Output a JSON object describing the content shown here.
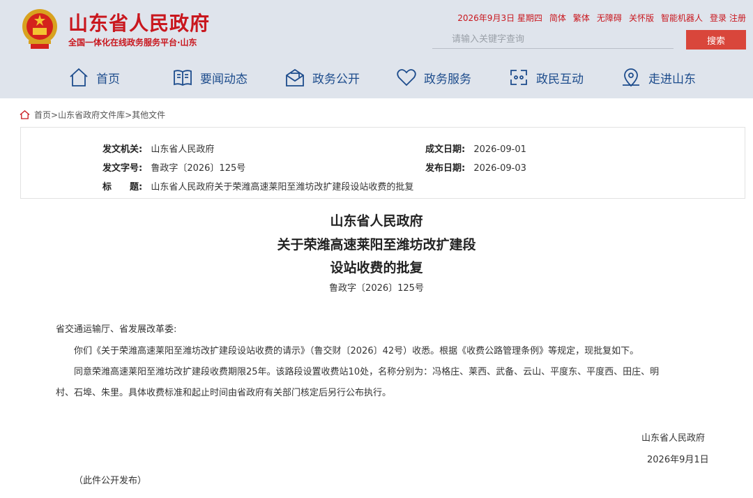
{
  "header": {
    "title": "山东省人民政府",
    "subtitle": "全国一体化在线政务服务平台·山东",
    "date": "2026年9月3日 星期四",
    "links": [
      "简体",
      "繁体",
      "无障碍",
      "关怀版",
      "智能机器人"
    ],
    "login": "登录",
    "register": "注册",
    "search_placeholder": "请输入关键字查询",
    "search_button": "搜索",
    "brand_color": "#c9171e"
  },
  "nav": {
    "items": [
      {
        "label": "首页",
        "icon": "home-icon"
      },
      {
        "label": "要闻动态",
        "icon": "book-icon"
      },
      {
        "label": "政务公开",
        "icon": "mailbox-icon"
      },
      {
        "label": "政务服务",
        "icon": "heart-icon"
      },
      {
        "label": "政民互动",
        "icon": "interaction-icon"
      },
      {
        "label": "走进山东",
        "icon": "location-icon"
      }
    ]
  },
  "breadcrumb": {
    "items": [
      "首页",
      "山东省政府文件库",
      "其他文件"
    ],
    "separator": ">"
  },
  "meta": {
    "issuer_label": "发文机关:",
    "issuer": "山东省人民政府",
    "doc_no_label": "发文字号:",
    "doc_no": "鲁政字〔2026〕125号",
    "title_label": "标　　题:",
    "title": "山东省人民政府关于荣潍高速莱阳至潍坊改扩建段设站收费的批复",
    "made_label": "成文日期:",
    "made_date": "2026-09-01",
    "pub_label": "发布日期:",
    "pub_date": "2026-09-03"
  },
  "document": {
    "title_lines": [
      "山东省人民政府",
      "关于荣潍高速莱阳至潍坊改扩建段",
      "设站收费的批复"
    ],
    "number": "鲁政字〔2026〕125号",
    "salutation": "省交通运输厅、省发展改革委:",
    "para1": "你们《关于荣潍高速莱阳至潍坊改扩建段设站收费的请示》（鲁交财〔2026〕42号）收悉。根据《收费公路管理条例》等规定，现批复如下。",
    "para2_line1": "同意荣潍高速莱阳至潍坊改扩建段收费期限25年。该路段设置收费站10处，名称分别为：冯格庄、莱西、武备、云山、平度东、平度西、田庄、明",
    "para2_line2": "村、石埠、朱里。具体收费标准和起止时间由省政府有关部门核定后另行公布执行。",
    "signature": "山东省人民政府",
    "sign_date": "2026年9月1日",
    "note": "（此件公开发布）"
  }
}
